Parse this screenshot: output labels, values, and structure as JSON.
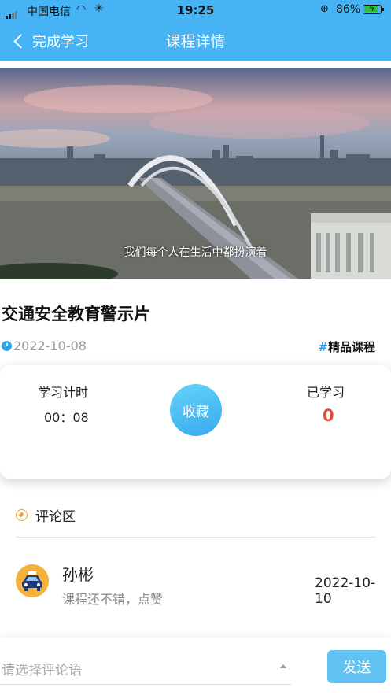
{
  "status_bar": {
    "carrier": "中国电信",
    "time": "19:25",
    "battery": "86%",
    "battery_level": 0.86
  },
  "nav": {
    "back_label": "完成学习",
    "title": "课程详情"
  },
  "video": {
    "subtitle": "我们每个人在生活中都扮演着"
  },
  "course": {
    "title": "交通安全教育警示片",
    "date": "2022-10-08",
    "tag_hash": "#",
    "tag": "精品课程"
  },
  "stats": {
    "timer_label": "学习计时",
    "timer_value": "00：08",
    "favorite_label": "收藏",
    "studied_label": "已学习",
    "studied_value": "0"
  },
  "comments": {
    "header": "评论区",
    "items": [
      {
        "user": "孙彬",
        "text": "课程还不错，点赞",
        "date": "2022-10-10"
      }
    ]
  },
  "input": {
    "placeholder": "请选择评论语",
    "send_label": "发送"
  },
  "colors": {
    "primary": "#45b3f4",
    "studied_count": "#e14b3b",
    "avatar_bg": "#f4b13c"
  },
  "icons": [
    "signal-icon",
    "wifi-icon",
    "loading-icon",
    "lock-rotation-icon",
    "battery-icon",
    "back-chevron-icon",
    "clock-icon",
    "compass-icon",
    "taxi-avatar-icon",
    "caret-up-icon"
  ]
}
